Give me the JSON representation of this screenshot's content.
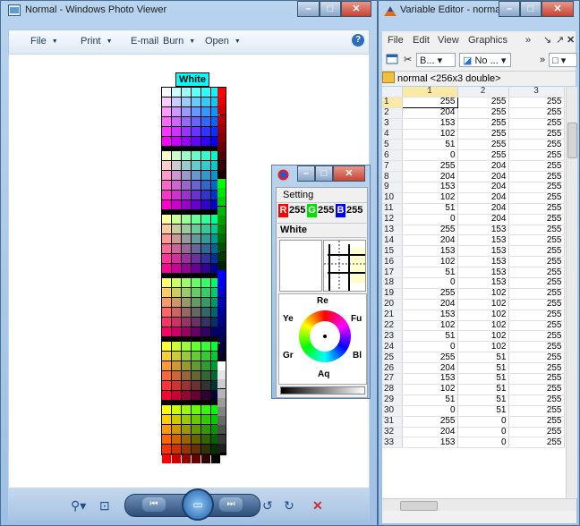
{
  "photo_viewer": {
    "title": "Normal - Windows Photo Viewer",
    "menu": [
      {
        "label": "File"
      },
      {
        "label": "Print"
      },
      {
        "label": "E-mail"
      },
      {
        "label": "Burn"
      },
      {
        "label": "Open"
      }
    ],
    "dropdown_arrow": "▼",
    "help_icon": "?",
    "image_label": "White",
    "window_controls": {
      "minimize": "–",
      "maximize": "□",
      "close": "✕"
    },
    "bottom_controls": {
      "zoom": "⚲▾",
      "actual_size": "⊡",
      "previous": "⏮",
      "slideshow": "▭",
      "next": "⏭",
      "rotate_ccw": "↺",
      "rotate_cw": "↻",
      "delete": "✕"
    }
  },
  "color_tool": {
    "setting_label": "Setting",
    "r_label": "R",
    "r_value": "255",
    "g_label": "G",
    "g_value": "255",
    "b_label": "B",
    "b_value": "255",
    "color_name": "White",
    "wheel_labels": {
      "top": "Re",
      "top_right": "Fu",
      "right": "Bl",
      "bottom": "Aq",
      "left": "Gr",
      "top_left": "Ye"
    },
    "window_controls": {
      "minimize": "–",
      "maximize": "□",
      "close": "✕"
    }
  },
  "variable_editor": {
    "title": "Variable Editor - normal",
    "menu": [
      {
        "label": "File"
      },
      {
        "label": "Edit"
      },
      {
        "label": "View"
      },
      {
        "label": "Graphics"
      }
    ],
    "menu_overflow": "»",
    "toolbar": {
      "base_dropdown": "B...",
      "plot_dropdown": "No ...",
      "overflow": "»"
    },
    "variable_label": "normal <256x3 double>",
    "columns": [
      "1",
      "2",
      "3"
    ],
    "rows": [
      [
        1,
        255,
        255,
        255
      ],
      [
        2,
        204,
        255,
        255
      ],
      [
        3,
        153,
        255,
        255
      ],
      [
        4,
        102,
        255,
        255
      ],
      [
        5,
        51,
        255,
        255
      ],
      [
        6,
        0,
        255,
        255
      ],
      [
        7,
        255,
        204,
        255
      ],
      [
        8,
        204,
        204,
        255
      ],
      [
        9,
        153,
        204,
        255
      ],
      [
        10,
        102,
        204,
        255
      ],
      [
        11,
        51,
        204,
        255
      ],
      [
        12,
        0,
        204,
        255
      ],
      [
        13,
        255,
        153,
        255
      ],
      [
        14,
        204,
        153,
        255
      ],
      [
        15,
        153,
        153,
        255
      ],
      [
        16,
        102,
        153,
        255
      ],
      [
        17,
        51,
        153,
        255
      ],
      [
        18,
        0,
        153,
        255
      ],
      [
        19,
        255,
        102,
        255
      ],
      [
        20,
        204,
        102,
        255
      ],
      [
        21,
        153,
        102,
        255
      ],
      [
        22,
        102,
        102,
        255
      ],
      [
        23,
        51,
        102,
        255
      ],
      [
        24,
        0,
        102,
        255
      ],
      [
        25,
        255,
        51,
        255
      ],
      [
        26,
        204,
        51,
        255
      ],
      [
        27,
        153,
        51,
        255
      ],
      [
        28,
        102,
        51,
        255
      ],
      [
        29,
        51,
        51,
        255
      ],
      [
        30,
        0,
        51,
        255
      ],
      [
        31,
        255,
        0,
        255
      ],
      [
        32,
        204,
        0,
        255
      ],
      [
        33,
        153,
        0,
        255
      ]
    ],
    "window_controls": {
      "minimize": "–",
      "maximize": "□",
      "close": "✕"
    }
  }
}
